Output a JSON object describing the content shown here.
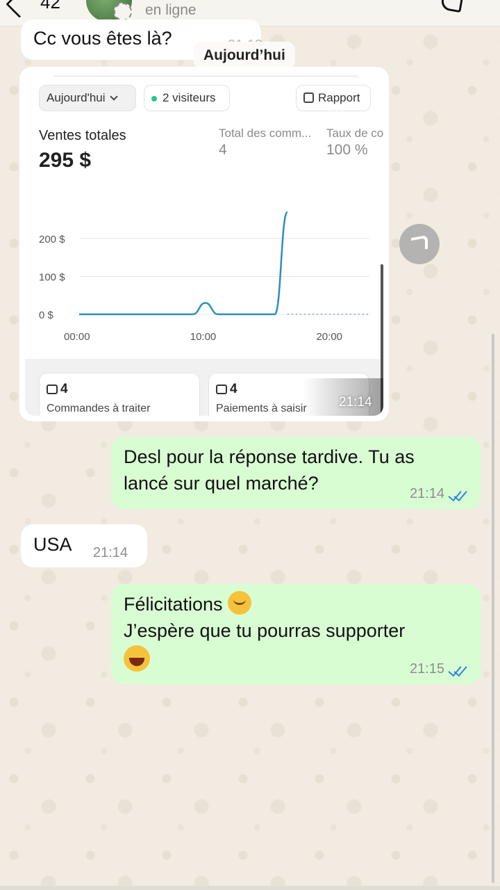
{
  "header": {
    "unread_count": "42",
    "contact_status": "en ligne"
  },
  "messages": {
    "first": {
      "text": "Cc vous êtes là?",
      "time": "21:13"
    },
    "date_separator": "Aujourd’hui",
    "image": {
      "time": "21:14",
      "screenshot": {
        "period_selector": "Aujourd'hui",
        "visitors_badge": "2 visiteurs",
        "report_button": "Rapport",
        "total_sales_label": "Ventes totales",
        "total_sales_value": "295 $",
        "orders_total_label": "Total des comm...",
        "orders_total_value": "4",
        "rate_label": "Taux de co",
        "rate_value": "100 %",
        "orders_card": {
          "count": "4",
          "label": "Commandes à traiter"
        },
        "payments_card": {
          "count": "4",
          "label": "Paiements à saisir"
        }
      }
    },
    "reply1": {
      "line1": "Desl pour la réponse tardive. Tu as",
      "line2": "lancé sur quel marché?",
      "time": "21:14"
    },
    "usa": {
      "text": "USA",
      "time": "21:14"
    },
    "reply2": {
      "line1": "Félicitations",
      "line2": "J’espère que tu pourras supporter",
      "time": "21:15"
    }
  },
  "chart_data": {
    "type": "line",
    "x_ticks": [
      "00:00",
      "10:00",
      "20:00"
    ],
    "y_ticks": [
      "0 $",
      "100 $",
      "200 $"
    ],
    "ylim": [
      0,
      290
    ],
    "xlim": [
      0,
      23
    ],
    "series": [
      {
        "points": [
          [
            0,
            0
          ],
          [
            9,
            0
          ],
          [
            10,
            30
          ],
          [
            11,
            0
          ],
          [
            15.5,
            0
          ],
          [
            16.5,
            270
          ]
        ],
        "color": "#2a8fb8"
      }
    ],
    "baseline_color": "#6aa8c4"
  },
  "colors": {
    "incoming_bubble": "#ffffff",
    "outgoing_bubble": "#d9fdd3",
    "read_ticks": "#2b87e0"
  }
}
